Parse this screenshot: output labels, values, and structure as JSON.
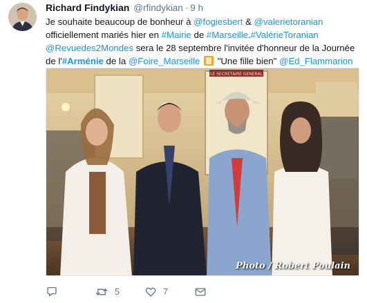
{
  "tweet": {
    "author": {
      "display_name": "Richard Findykian",
      "handle": "@rfindykian",
      "separator": "·",
      "time": "9 h"
    },
    "text_segments": [
      {
        "t": "Je souhaite beaucoup de bonheur à ",
        "k": "text"
      },
      {
        "t": "@fogiesbert",
        "k": "link"
      },
      {
        "t": " & ",
        "k": "text"
      },
      {
        "t": "@valerietoranian",
        "k": "link"
      },
      {
        "t": " officiellement mariés hier en ",
        "k": "text"
      },
      {
        "t": "#Mairie",
        "k": "link"
      },
      {
        "t": " de ",
        "k": "text"
      },
      {
        "t": "#Marseille",
        "k": "link"
      },
      {
        "t": ".",
        "k": "text"
      },
      {
        "t": "#ValérieToranian",
        "k": "link"
      },
      {
        "t": " ",
        "k": "text"
      },
      {
        "t": "@Revuedes2Mondes",
        "k": "link"
      },
      {
        "t": " sera le 28 septembre l'invitée d'honneur de la Journée de l'",
        "k": "text"
      },
      {
        "t": "#Arménie",
        "k": "bold-link"
      },
      {
        "t": " de la ",
        "k": "text"
      },
      {
        "t": "@Foire_Marseille",
        "k": "link"
      },
      {
        "t": " ",
        "k": "text"
      },
      {
        "t": "",
        "k": "emoji"
      },
      {
        "t": " \"Une fille bien\" ",
        "k": "text"
      },
      {
        "t": "@Ed_Flammarion",
        "k": "link"
      }
    ],
    "photo": {
      "credit": "Photo / Robert Poulain",
      "sign_text": "LE SECRETAIRE GENERAL"
    },
    "actions": {
      "reply_count": "",
      "retweet_count": "5",
      "like_count": "7"
    },
    "icons": {
      "reply": "reply-icon",
      "retweet": "retweet-icon",
      "like": "heart-icon",
      "message": "envelope-icon"
    },
    "colors": {
      "link": "#1b95e0",
      "muted": "#657786",
      "text": "#14171a"
    }
  }
}
